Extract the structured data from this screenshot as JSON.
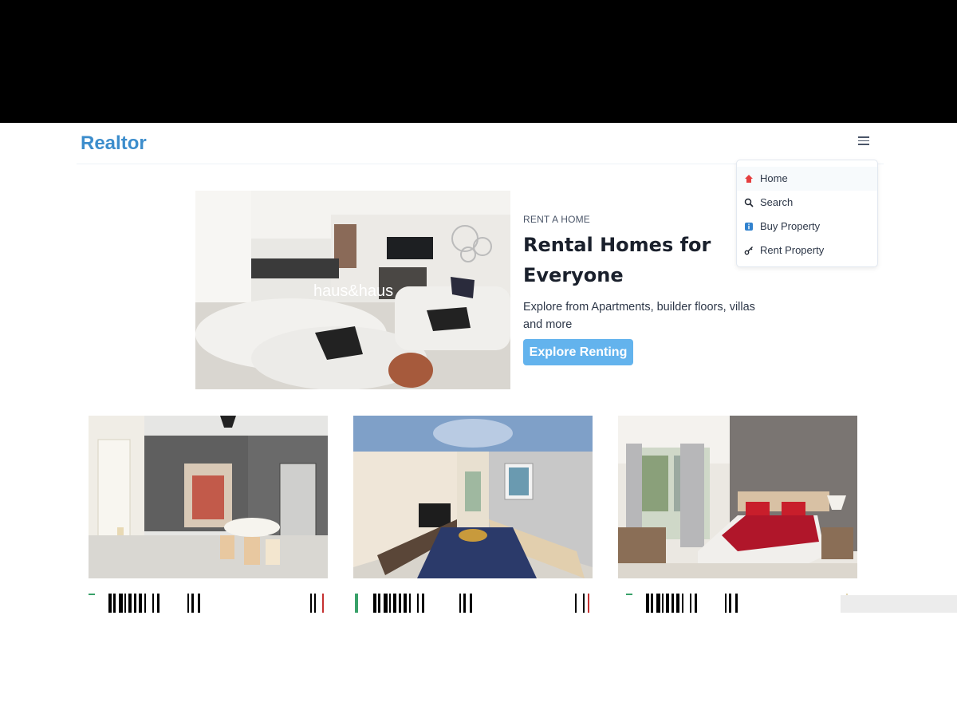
{
  "brand": {
    "logo": "Realtor"
  },
  "menu": {
    "items": [
      {
        "label": "Home",
        "icon": "home-icon"
      },
      {
        "label": "Search",
        "icon": "search-icon"
      },
      {
        "label": "Buy Property",
        "icon": "info-icon"
      },
      {
        "label": "Rent Property",
        "icon": "key-icon"
      }
    ]
  },
  "hero": {
    "eyebrow": "RENT A HOME",
    "title_line1": "Rental Homes for",
    "title_line2": "Everyone",
    "desc_line1": "Explore from Apartments, builder floors, villas",
    "desc_line2": "and more",
    "button": "Explore Renting",
    "image_watermark": "haus&haus"
  },
  "colors": {
    "brand": "#3c8dcc",
    "button": "#63b3ed",
    "verified": "#38a169"
  }
}
